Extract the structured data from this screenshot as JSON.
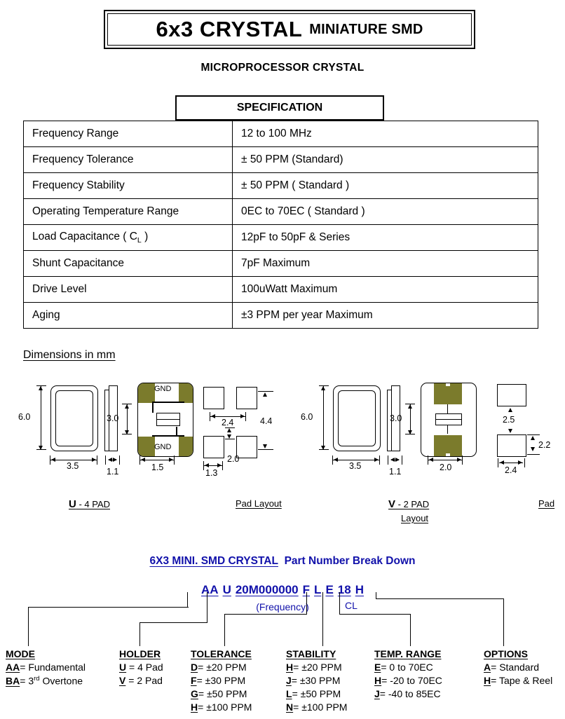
{
  "title": {
    "main": "6x3 CRYSTAL",
    "sub": "MINIATURE SMD",
    "subtitle": "MICROPROCESSOR CRYSTAL"
  },
  "spec_table": {
    "header": "SPECIFICATION",
    "rows": [
      {
        "label": "Frequency Range",
        "label_sub": "",
        "value": "12  to 100 MHz"
      },
      {
        "label": "Frequency Tolerance",
        "label_sub": "",
        "value": "± 50 PPM (Standard)"
      },
      {
        "label": "Frequency Stability",
        "label_sub": "",
        "value": "± 50 PPM ( Standard )"
      },
      {
        "label": "Operating Temperature Range",
        "label_sub": "",
        "value": "0EC to 70EC ( Standard )"
      },
      {
        "label": "Load Capacitance ( C",
        "label_sub": "L",
        "label_tail": " )",
        "value": "12pF to 50pF & Series"
      },
      {
        "label": "Shunt Capacitance",
        "label_sub": "",
        "value": "7pF Maximum"
      },
      {
        "label": "Drive Level",
        "label_sub": "",
        "value": "100uWatt Maximum"
      },
      {
        "label": "Aging",
        "label_sub": "",
        "value": "±3 PPM per year Maximum"
      }
    ]
  },
  "dimensions": {
    "heading": "Dimensions in mm",
    "olive_color": "#7b7b2c",
    "u_view": {
      "caption_bold": "U",
      "caption_rest": " - 4 PAD",
      "height": "6.0",
      "width": "3.5",
      "thickness": "1.1",
      "pad_height": "3.0",
      "pad_width": "1.5",
      "gnd_top": "GND",
      "gnd_bottom": "GND"
    },
    "u_pad_layout": {
      "caption": "Pad Layout",
      "pitch_x": "2.4",
      "span_y": "4.4",
      "pad_w": "1.3",
      "gap_y": "2.0"
    },
    "v_view": {
      "caption_bold": "V",
      "caption_rest": " - 2 PAD",
      "caption_wrap": "Layout",
      "height": "6.0",
      "width": "3.5",
      "thickness": "1.1",
      "pad_height": "3.0",
      "pad_width": "2.0"
    },
    "v_pad_layout": {
      "caption": "Pad",
      "gap_y": "2.5",
      "pad_h": "2.2",
      "pad_w": "2.4"
    }
  },
  "part_number": {
    "heading_underlined": "6X3 MINI. SMD CRYSTAL",
    "heading_rest": "Part Number Break Down",
    "segments": [
      {
        "text": "AA",
        "underline": true
      },
      {
        "text": "U",
        "underline": true
      },
      {
        "text": "20M000000",
        "underline": true
      },
      {
        "text": "F",
        "underline": true
      },
      {
        "text": "L",
        "underline": true
      },
      {
        "text": "E",
        "underline": true
      },
      {
        "text": "18",
        "underline": true
      },
      {
        "text": "H",
        "underline": true
      }
    ],
    "frequency_note": "(Frequency)",
    "cl_note": "CL"
  },
  "legend": {
    "columns": [
      {
        "heading": "MODE",
        "items": [
          {
            "code": "AA",
            "sep": "= ",
            "sup": "",
            "text": "Fundamental"
          },
          {
            "code": "BA",
            "sep": "= ",
            "sup": "rd",
            "pre": "3",
            "text": " Overtone"
          }
        ]
      },
      {
        "heading": "HOLDER",
        "items": [
          {
            "code": "U",
            "sep": " = ",
            "text": "4 Pad"
          },
          {
            "code": "V",
            "sep": " = ",
            "text": "2 Pad"
          }
        ]
      },
      {
        "heading": "TOLERANCE",
        "items": [
          {
            "code": "D",
            "sep": "= ",
            "text": "±20 PPM"
          },
          {
            "code": "F",
            "sep": "= ",
            "text": "±30 PPM"
          },
          {
            "code": "G",
            "sep": "= ",
            "text": "±50 PPM"
          },
          {
            "code": "H",
            "sep": "= ",
            "text": "±100 PPM"
          }
        ]
      },
      {
        "heading": "STABILITY",
        "items": [
          {
            "code": "H",
            "sep": "= ",
            "text": "±20 PPM"
          },
          {
            "code": "J",
            "sep": "=  ",
            "text": "±30 PPM"
          },
          {
            "code": "L",
            "sep": "=  ",
            "text": "±50 PPM"
          },
          {
            "code": "N",
            "sep": "=  ",
            "text": "±100 PPM"
          }
        ]
      },
      {
        "heading": "TEMP. RANGE",
        "items": [
          {
            "code": "E",
            "sep": "= ",
            "text": "0 to 70EC"
          },
          {
            "code": "H",
            "sep": "= ",
            "text": "-20 to 70EC"
          },
          {
            "code": "J",
            "sep": "=  ",
            "text": "-40 to 85EC"
          }
        ]
      },
      {
        "heading": "OPTIONS",
        "items": [
          {
            "code": "A",
            "sep": "= ",
            "text": "Standard"
          },
          {
            "code": "H",
            "sep": "= ",
            "text": "Tape & Reel"
          }
        ]
      }
    ]
  }
}
